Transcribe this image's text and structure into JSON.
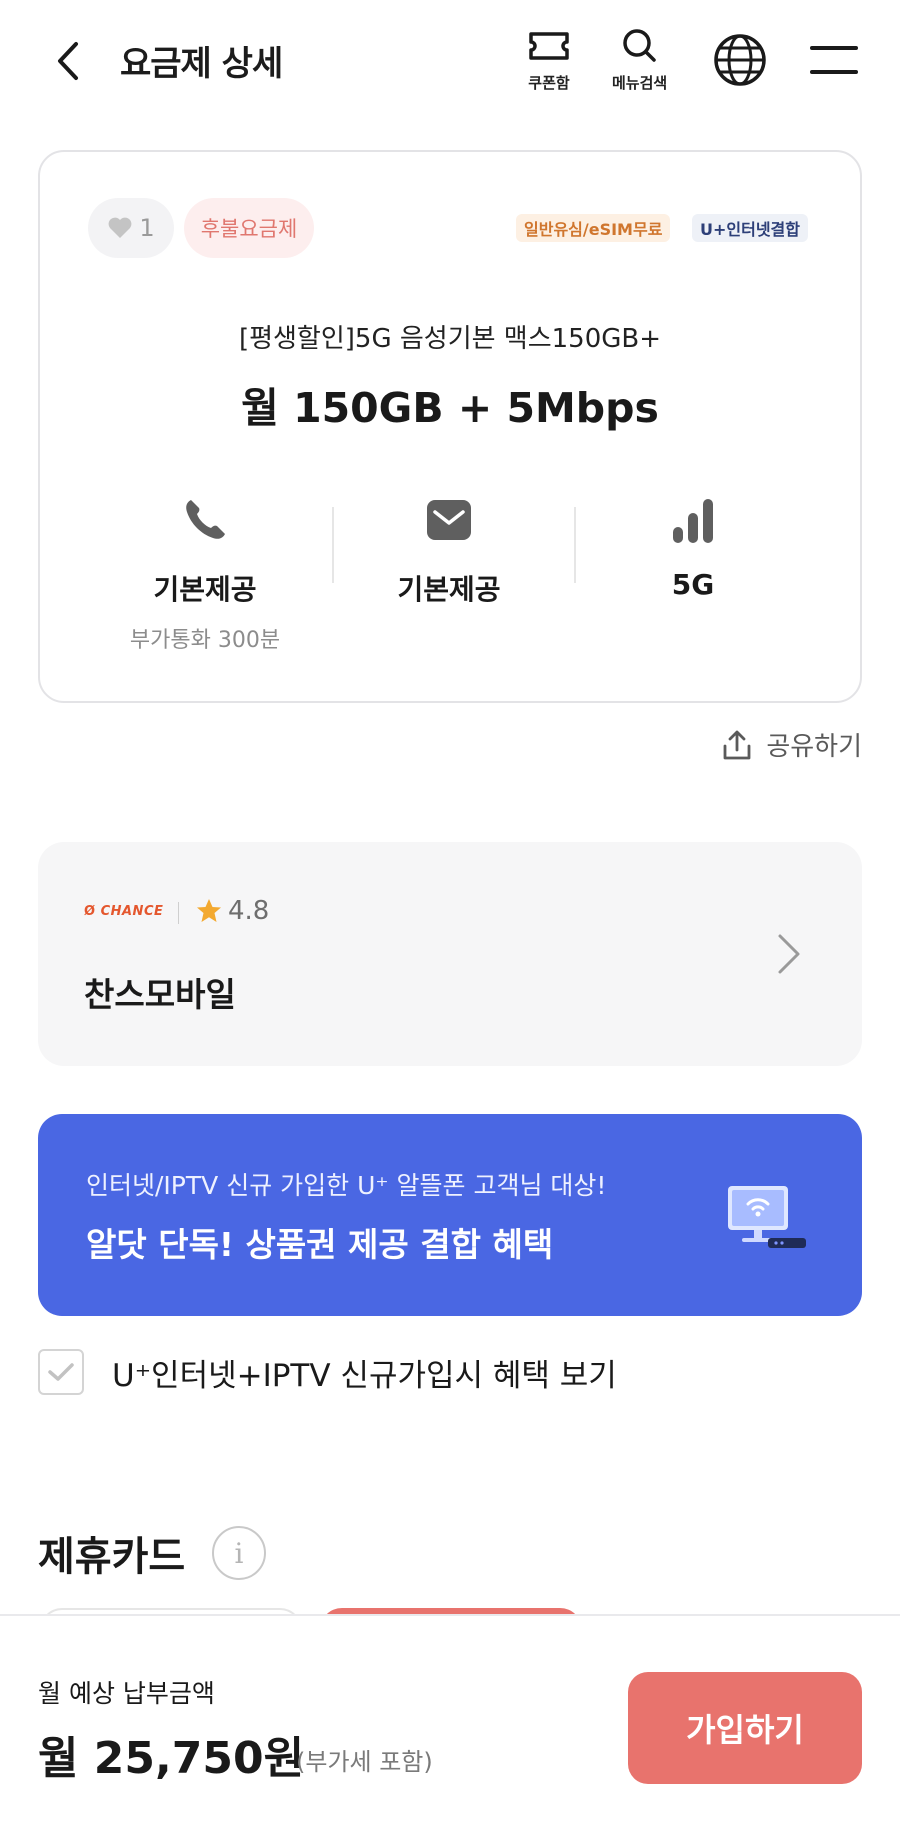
{
  "header": {
    "title": "요금제 상세",
    "coupon_label": "쿠폰함",
    "search_label": "메뉴검색"
  },
  "plan": {
    "likes": "1",
    "type_chip": "후불요금제",
    "tags": [
      "일반유심/eSIM무료",
      "U+인터넷결합"
    ],
    "name": "[평생할인]5G 음성기본 맥스150GB+",
    "data": "월 150GB + 5Mbps",
    "features": [
      {
        "icon": "phone-icon",
        "value": "기본제공",
        "sub": "부가통화 300분"
      },
      {
        "icon": "message-icon",
        "value": "기본제공",
        "sub": ""
      },
      {
        "icon": "signal-icon",
        "value": "5G",
        "sub": ""
      }
    ],
    "share_label": "공유하기"
  },
  "company": {
    "logo_text": "CHANCE",
    "rating": "4.8",
    "name": "찬스모바일"
  },
  "promo": {
    "subtitle": "인터넷/IPTV 신규 가입한 U⁺ 알뜰폰 고객님 대상!",
    "title": "알닷 단독! 상품권 제공 결합 혜택"
  },
  "benefit_checkbox": {
    "label": "U⁺인터넷+IPTV 신규가입시 혜택 보기",
    "checked": true
  },
  "partner_section": {
    "title": "제휴카드"
  },
  "bottom": {
    "est_label": "월 예상 납부금액",
    "amount": "월 25,750원",
    "vat_note": "(부가세 포함)",
    "join_label": "가입하기"
  },
  "colors": {
    "accent": "#e8736d",
    "promo_bg": "#4a67e3",
    "usim_tag": "#d0762e",
    "net_tag": "#2d3f78"
  }
}
